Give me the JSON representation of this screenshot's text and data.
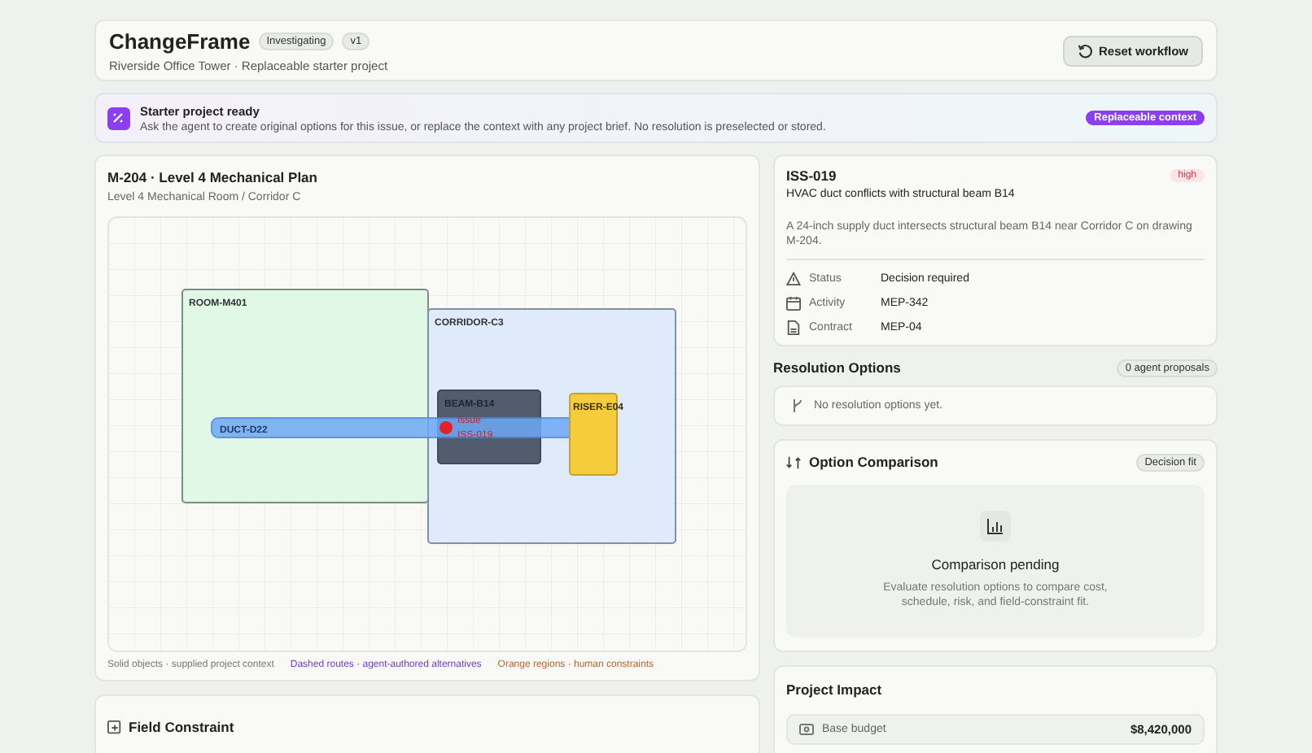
{
  "header": {
    "title": "ChangeFrame",
    "badges": [
      "Investigating",
      "v1"
    ],
    "subtitle": "Riverside Office Tower · Replaceable starter project",
    "reset_button": "Reset workflow"
  },
  "banner": {
    "title": "Starter project ready",
    "text": "Ask the agent to create original options for this issue, or replace the context with any project brief. No resolution is preselected or stored.",
    "badge": "Replaceable context"
  },
  "plan": {
    "title": "M-204 · Level 4 Mechanical Plan",
    "subtitle": "Level 4 Mechanical Room / Corridor C",
    "objects": [
      {
        "kind": "room",
        "label": "ROOM-M401"
      },
      {
        "kind": "corridor",
        "label": "CORRIDOR-C3"
      },
      {
        "kind": "beam",
        "label": "BEAM-B14"
      },
      {
        "kind": "duct",
        "label": "DUCT-D22"
      },
      {
        "kind": "riser",
        "label": "RISER-E04"
      }
    ],
    "issue_marker": {
      "label": "Issue",
      "id": "ISS-019"
    },
    "legend": [
      {
        "kind": "solid",
        "text": "Solid objects · supplied project context"
      },
      {
        "kind": "dashed",
        "text": "Dashed routes · agent-authored alternatives"
      },
      {
        "kind": "orange",
        "text": "Orange regions · human constraints"
      }
    ]
  },
  "field_constraint": {
    "title": "Field Constraint"
  },
  "issue": {
    "id": "ISS-019",
    "priority": "high",
    "title": "HVAC duct conflicts with structural beam B14",
    "description": "A 24-inch supply duct intersects structural beam B14 near Corridor C on drawing M-204.",
    "fields": [
      {
        "kind": "status",
        "label": "Status",
        "value": "Decision required"
      },
      {
        "kind": "activity",
        "label": "Activity",
        "value": "MEP-342"
      },
      {
        "kind": "contract",
        "label": "Contract",
        "value": "MEP-04"
      }
    ]
  },
  "resolution": {
    "title": "Resolution Options",
    "count": "0 agent proposals",
    "empty": "No resolution options yet."
  },
  "comparison": {
    "title": "Option Comparison",
    "badge": "Decision fit",
    "empty_title": "Comparison pending",
    "empty_text": "Evaluate resolution options to compare cost, schedule, risk, and field-constraint fit."
  },
  "impact": {
    "title": "Project Impact",
    "rows": [
      {
        "label": "Base budget",
        "value": "$8,420,000"
      }
    ]
  }
}
